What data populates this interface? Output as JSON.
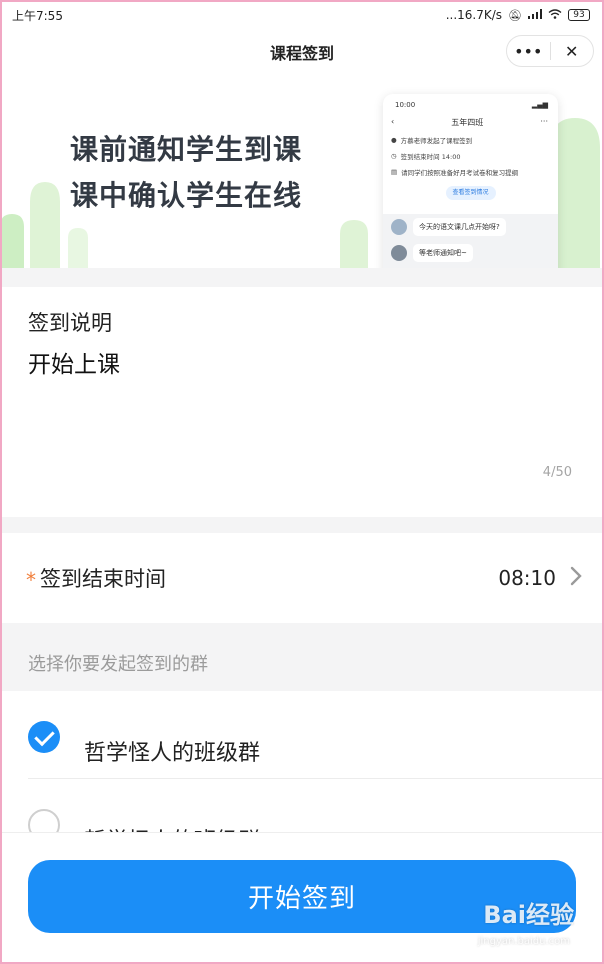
{
  "status_bar": {
    "time": "上午7:55",
    "network_speed": "...16.7K/s",
    "battery": "93"
  },
  "nav": {
    "title": "课程签到",
    "more_icon": "more-dots-icon",
    "close_icon": "close-icon"
  },
  "banner": {
    "line1": "课前通知学生到课",
    "line2": "课中确认学生在线",
    "phone": {
      "time": "10:00",
      "title": "五年四班",
      "notice": "方慕老师发起了课程签到",
      "end_time": "签到结束时间 14:00",
      "note": "请同学们按照准备好月考试卷和复习提纲",
      "button": "查看签到情况",
      "chat1": "今天的语文课几点开始呀?",
      "chat2": "等老师通知吧~"
    }
  },
  "description": {
    "label": "签到说明",
    "value": "开始上课",
    "counter": "4/50"
  },
  "end_time": {
    "required_mark": "*",
    "label": "签到结束时间",
    "value": "08:10"
  },
  "groups": {
    "hint": "选择你要发起签到的群",
    "items": [
      {
        "name": "哲学怪人的班级群",
        "selected": true
      },
      {
        "name": "哲学怪人的班级群",
        "selected": false
      }
    ]
  },
  "actions": {
    "start_label": "开始签到"
  },
  "watermark": {
    "brand": "Bai经验",
    "url": "jingyan.baidu.com"
  },
  "colors": {
    "primary": "#1b8ef7",
    "required": "#f07f3c",
    "hint": "#9b9b9b"
  }
}
